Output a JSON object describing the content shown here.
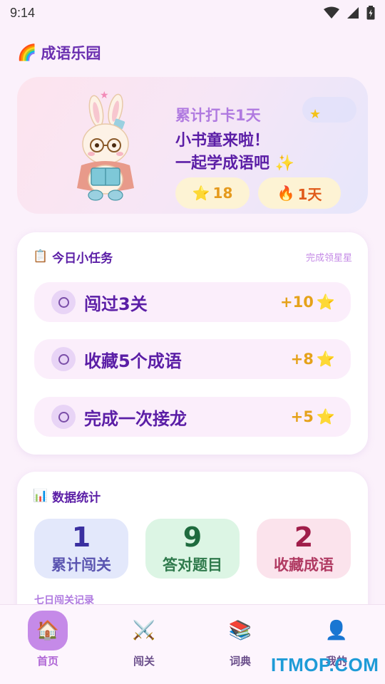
{
  "status_bar": {
    "time": "9:14"
  },
  "app": {
    "emoji": "🌈",
    "title": "成语乐园"
  },
  "hero": {
    "streak_label": "累计打卡1天",
    "greeting_line1": "小书童来啦！",
    "greeting_line2": "一起学成语吧 ✨",
    "stars_chip": {
      "icon": "⭐",
      "value": "18"
    },
    "days_chip": {
      "icon": "🔥",
      "value": "1天"
    }
  },
  "tasks": {
    "title_icon": "📋",
    "title": "今日小任务",
    "hint": "完成领星星",
    "items": [
      {
        "label": "闯过3关",
        "reward": "+10",
        "reward_icon": "⭐",
        "done": false
      },
      {
        "label": "收藏5个成语",
        "reward": "+8",
        "reward_icon": "⭐",
        "done": false
      },
      {
        "label": "完成一次接龙",
        "reward": "+5",
        "reward_icon": "⭐",
        "done": false
      }
    ]
  },
  "stats": {
    "title_icon": "📊",
    "title": "数据统计",
    "items": [
      {
        "value": "1",
        "label": "累计闯关"
      },
      {
        "value": "9",
        "label": "答对题目"
      },
      {
        "value": "2",
        "label": "收藏成语"
      }
    ],
    "week_label": "七日闯关记录"
  },
  "nav": {
    "items": [
      {
        "icon": "🏠",
        "label": "首页",
        "active": true
      },
      {
        "icon": "⚔️",
        "label": "闯关",
        "active": false
      },
      {
        "icon": "📚",
        "label": "词典",
        "active": false
      },
      {
        "icon": "👤",
        "label": "我的",
        "active": false
      }
    ]
  },
  "watermark": "ITMOP.COM",
  "colors": {
    "primary": "#5b1ea6",
    "accent": "#c58ae8",
    "background": "#fbf1fb",
    "star": "#e5a21a"
  }
}
